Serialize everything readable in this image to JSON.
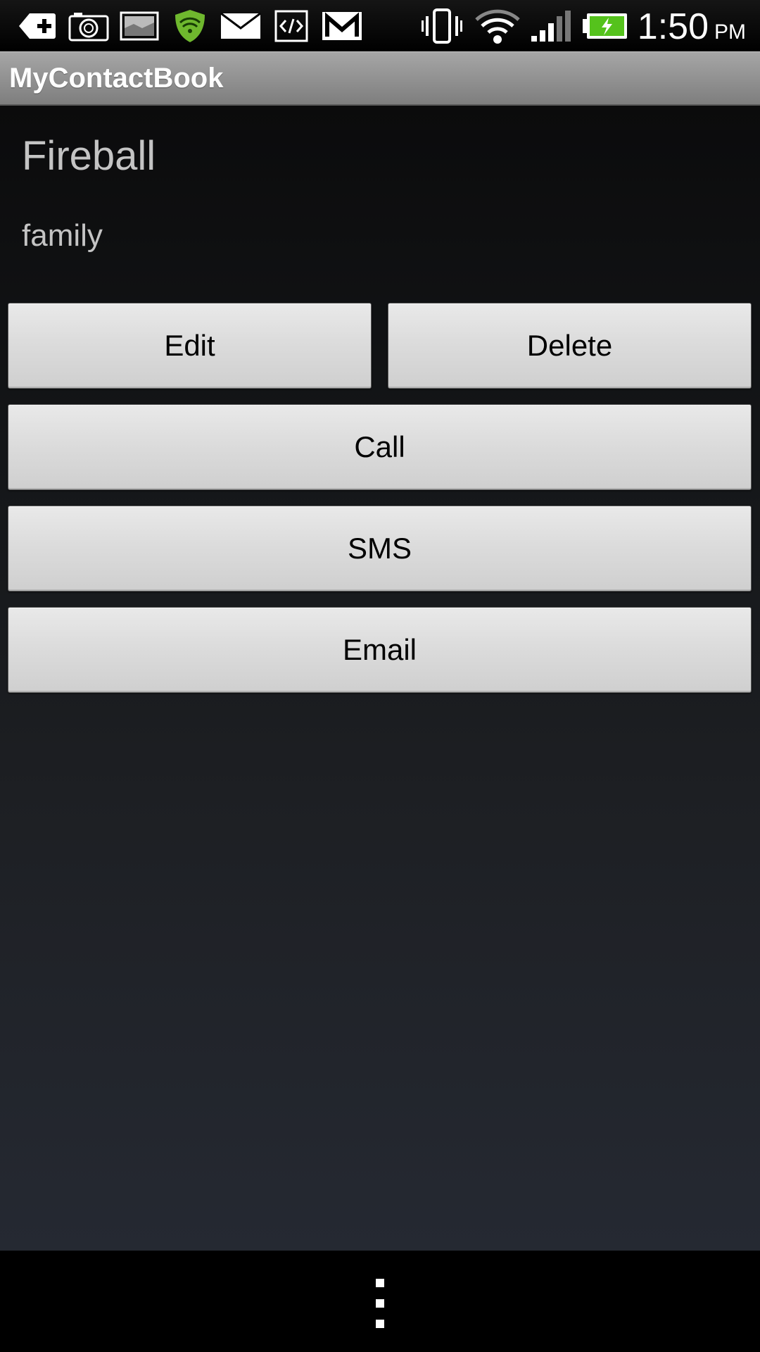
{
  "status_bar": {
    "time": "1:50",
    "ampm": "PM",
    "icons": [
      "add-contact-icon",
      "camera-icon",
      "gallery-icon",
      "security-shield-icon",
      "mail-icon",
      "code-icon",
      "gmail-icon",
      "vibrate-icon",
      "wifi-icon",
      "signal-icon",
      "battery-charging-icon"
    ],
    "battery_color": "#55c21c",
    "shield_color": "#6fb82e"
  },
  "action_bar": {
    "title": "MyContactBook"
  },
  "contact": {
    "name": "Fireball",
    "group": "family"
  },
  "buttons": {
    "edit": "Edit",
    "delete": "Delete",
    "call": "Call",
    "sms": "SMS",
    "email": "Email"
  },
  "nav": {
    "menu_icon": "overflow-menu-icon"
  }
}
